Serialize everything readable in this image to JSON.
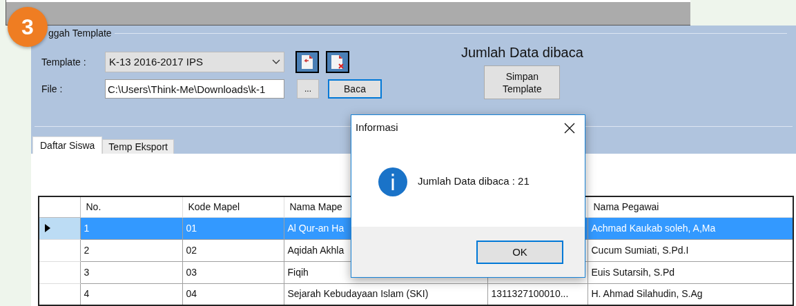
{
  "badge": "3",
  "group_title": "ggah Template",
  "template": {
    "label": "Template :",
    "value": "K-13 2016-2017 IPS"
  },
  "file": {
    "label": "File :",
    "value": "C:\\Users\\Think-Me\\Downloads\\k-1"
  },
  "browse_button": "...",
  "read_button": "Baca",
  "read_count_label": "Jumlah Data dibaca",
  "save_button": "Simpan Template",
  "tabs": [
    {
      "label": "Daftar Siswa",
      "selected": true
    },
    {
      "label": "Temp Eksport",
      "selected": false
    }
  ],
  "table": {
    "columns": [
      "No.",
      "Kode Mapel",
      "Nama Mape",
      null,
      "Nama Pegawai"
    ],
    "rows": [
      {
        "selected": true,
        "cells": [
          "1",
          "01",
          "Al Qur-an Ha",
          null,
          "Achmad Kaukab soleh, A,Ma"
        ]
      },
      {
        "selected": false,
        "cells": [
          "2",
          "02",
          "Aqidah Akhla",
          null,
          "Cucum Sumiati, S.Pd.I"
        ]
      },
      {
        "selected": false,
        "cells": [
          "3",
          "03",
          "Fiqih",
          null,
          "Euis Sutarsih, S.Pd"
        ]
      },
      {
        "selected": false,
        "cells": [
          "4",
          "04",
          "Sejarah Kebudayaan Islam (SKI)",
          "1311327100010...",
          "H. Ahmad Silahudin, S.Ag"
        ]
      }
    ]
  },
  "dialog": {
    "title": "Informasi",
    "message": "Jumlah Data dibaca : 21",
    "button": "OK"
  }
}
